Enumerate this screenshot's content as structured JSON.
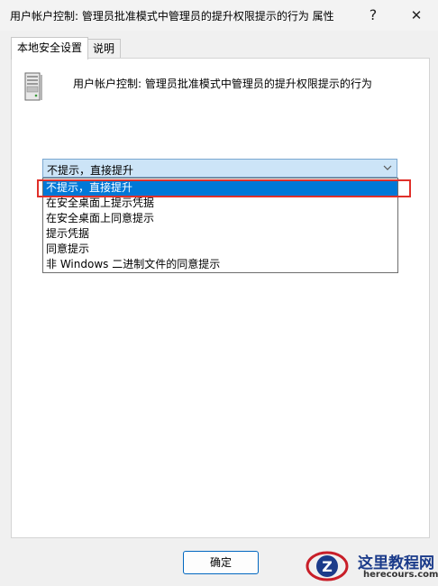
{
  "window": {
    "title": "用户帐户控制: 管理员批准模式中管理员的提升权限提示的行为 属性",
    "help_glyph": "?",
    "close_glyph": "✕"
  },
  "tabs": [
    {
      "label": "本地安全设置",
      "active": true
    },
    {
      "label": "说明",
      "active": false
    }
  ],
  "policy": {
    "icon": "server-computer-icon",
    "title": "用户帐户控制: 管理员批准模式中管理员的提升权限提示的行为"
  },
  "select": {
    "value": "不提示，直接提升",
    "options": [
      "不提示，直接提升",
      "在安全桌面上提示凭据",
      "在安全桌面上同意提示",
      "提示凭据",
      "同意提示",
      "非 Windows 二进制文件的同意提示"
    ],
    "selected_index": 0
  },
  "footer": {
    "ok_label": "确定"
  },
  "watermark": {
    "brand": "这里教程网",
    "url": "herecours.com"
  },
  "colors": {
    "selection": "#0078d7",
    "highlight": "#e0302a",
    "select_bg": "#cce4f7"
  }
}
